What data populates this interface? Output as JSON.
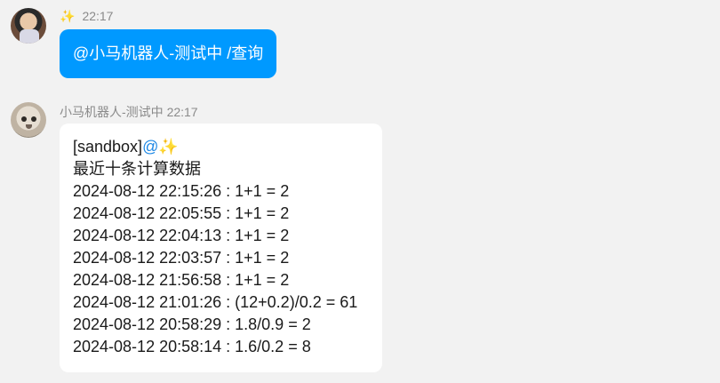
{
  "messages": [
    {
      "sender": "",
      "sender_emoji": "✨",
      "time": "22:17",
      "text": "@小马机器人-测试中 /查询"
    },
    {
      "sender": "小马机器人-测试中",
      "time": "22:17",
      "header": {
        "tag": "[sandbox]",
        "mention": "@",
        "emoji": "✨"
      },
      "title": "最近十条计算数据",
      "rows": [
        "2024-08-12 22:15:26 : 1+1 = 2",
        "2024-08-12 22:05:55 : 1+1 = 2",
        "2024-08-12 22:04:13 : 1+1 = 2",
        "2024-08-12 22:03:57 : 1+1 = 2",
        "2024-08-12 21:56:58 : 1+1 = 2",
        "2024-08-12 21:01:26 : (12+0.2)/0.2 = 61",
        "2024-08-12 20:58:29 : 1.8/0.9 = 2",
        "2024-08-12 20:58:14 : 1.6/0.2 = 8"
      ]
    }
  ],
  "colors": {
    "background": "#f2f2f2",
    "outgoing_bubble": "#0099ff",
    "incoming_bubble": "#ffffff",
    "mention": "#1e88e5",
    "meta_text": "#8a8a8a"
  },
  "icons": {
    "user_avatar": "child-photo-avatar",
    "bot_avatar": "cat-photo-avatar"
  }
}
